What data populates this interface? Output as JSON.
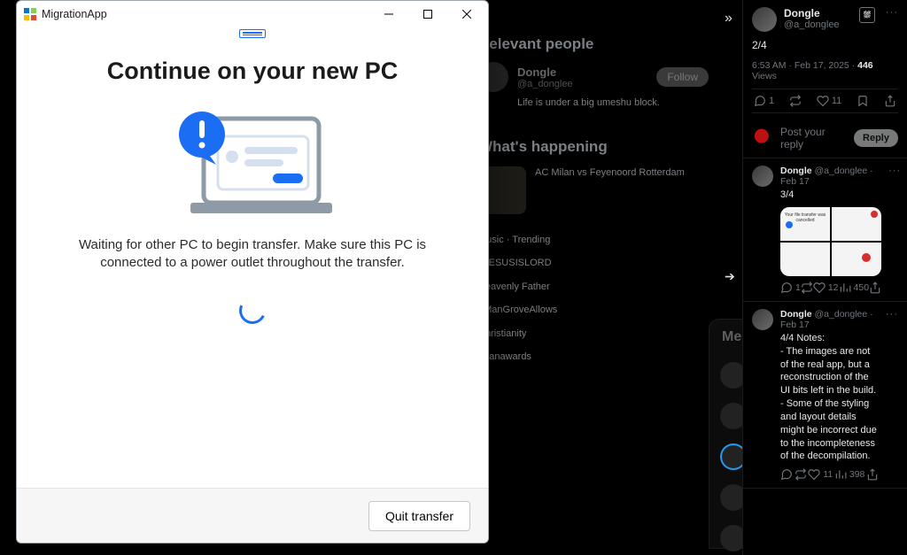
{
  "window": {
    "app_title": "MigrationApp",
    "heading": "Continue on your new PC",
    "description": "Waiting for other PC to begin transfer. Make sure this PC is connected to a power outlet throughout the transfer.",
    "quit_label": "Quit transfer"
  },
  "thread": {
    "main": {
      "author_name": "Dongle",
      "author_handle": "@a_donglee",
      "body": "2/4",
      "time": "6:53 AM",
      "date": "Feb 17, 2025",
      "views_count": "446",
      "views_label": "Views",
      "reply_count": "1",
      "like_count": "11"
    },
    "reply_placeholder": "Post your reply",
    "reply_button": "Reply",
    "sub1": {
      "author_name": "Dongle",
      "author_handle": "@a_donglee",
      "date": "Feb 17",
      "body": "3/4",
      "image_caption": "Your file transfer was cancelled",
      "reply_count": "1",
      "like_count": "12",
      "views": "450"
    },
    "sub2": {
      "author_name": "Dongle",
      "author_handle": "@a_donglee",
      "date": "Feb 17",
      "body": "4/4 Notes:\n- The images are not of the real app, but a reconstruction of the UI bits left in the build.\n- Some of the styling and layout details might be incorrect due to the incompleteness of the decompilation.",
      "like_count": "11",
      "views": "398"
    }
  },
  "backdrop": {
    "relevant_title": "Relevant people",
    "rel_user_name": "Dongle",
    "rel_user_bio": "Life is under a big umeshu block.",
    "follow_label": "Follow",
    "whats_title": "What's happening",
    "trend_line1": "AC Milan vs Feyenoord Rotterdam",
    "messages_title": "Messages"
  }
}
